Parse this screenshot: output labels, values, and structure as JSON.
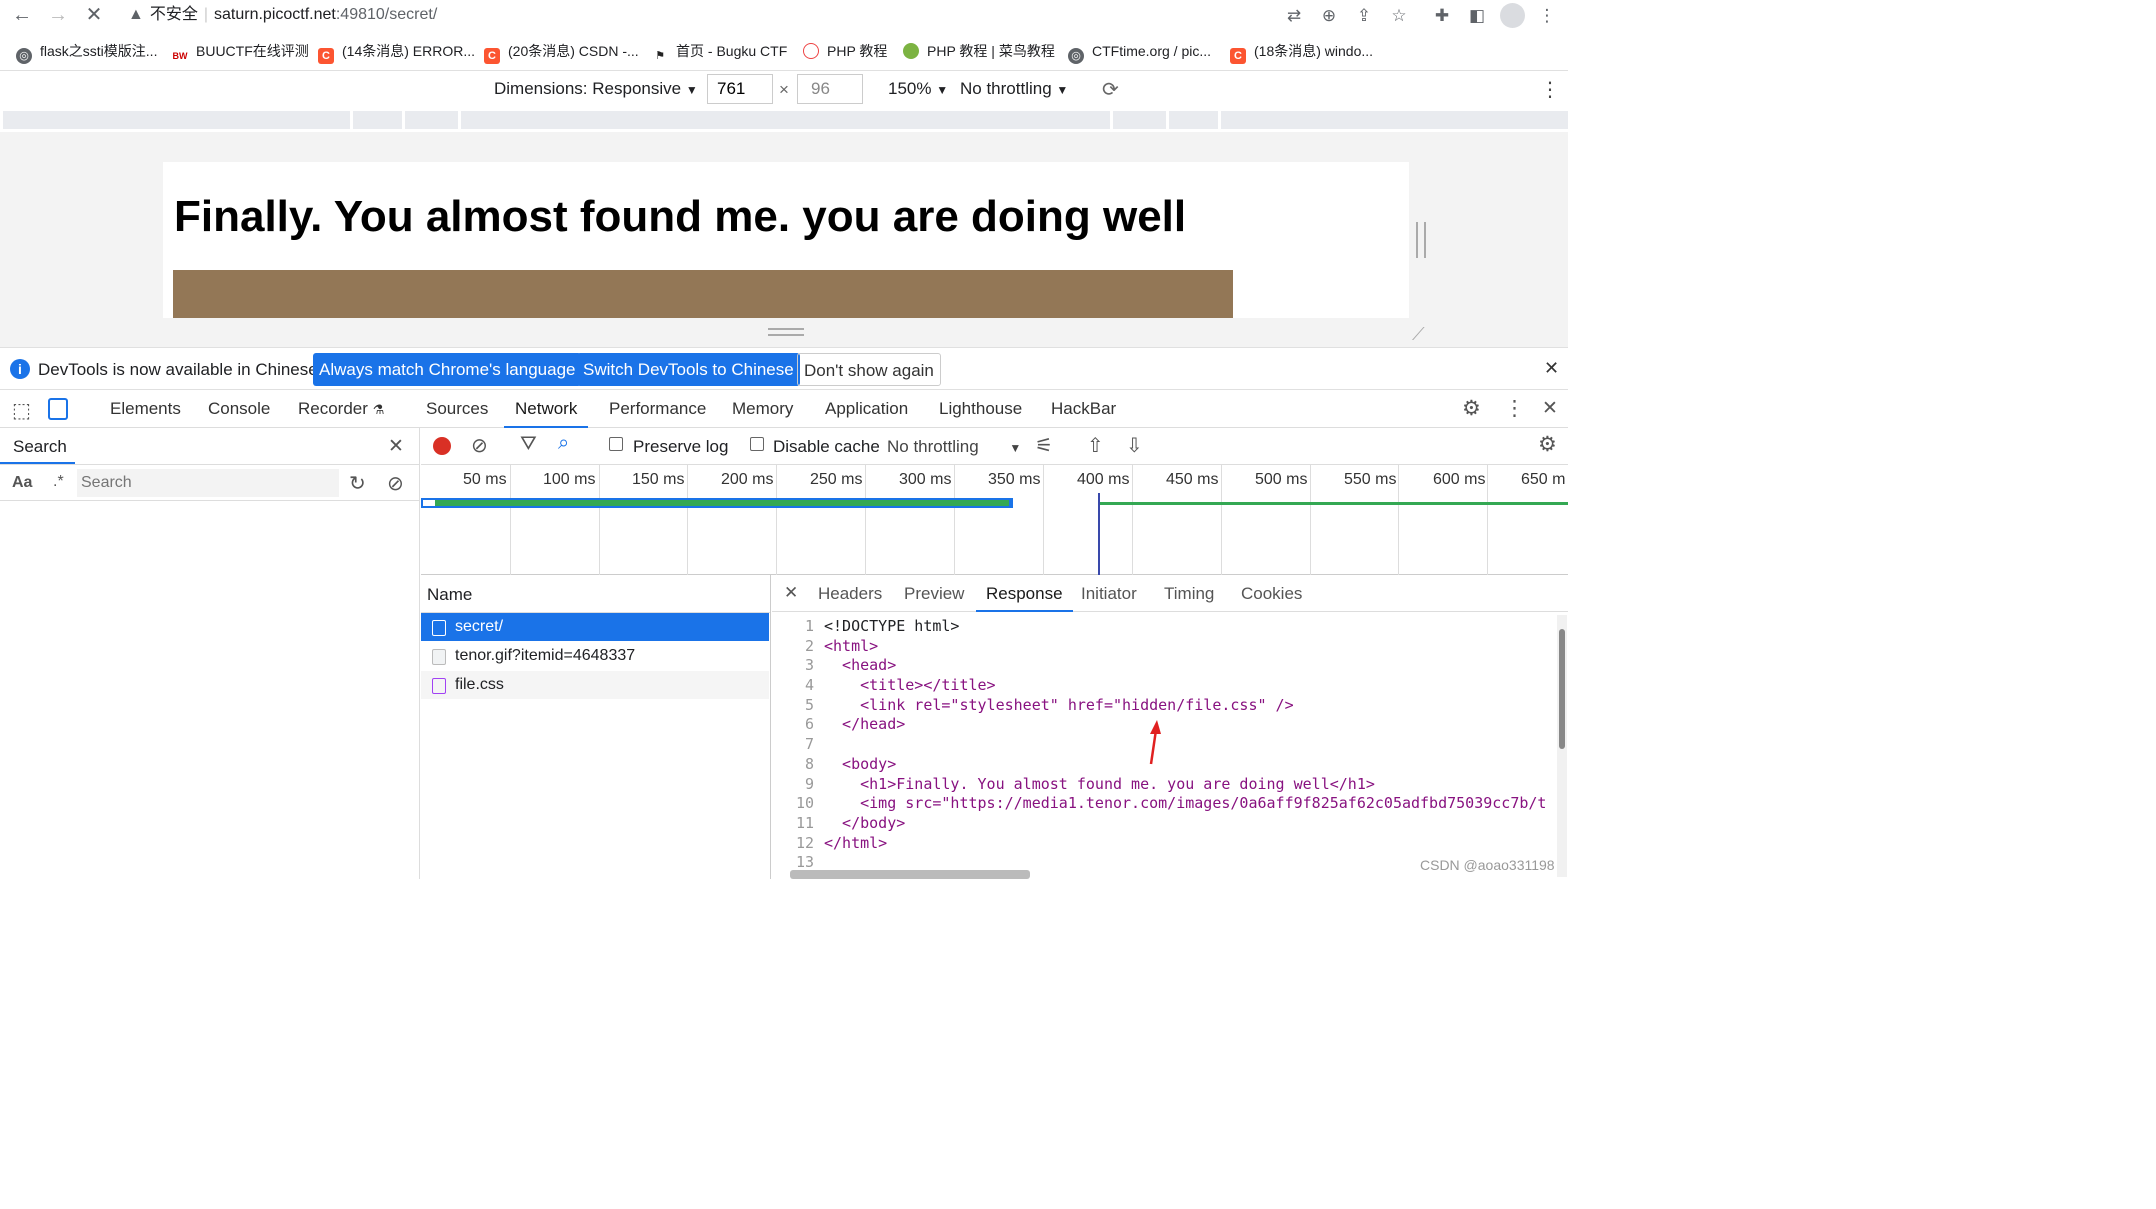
{
  "browser": {
    "url_warning": "不安全",
    "url_host": "saturn.picoctf.net",
    "url_path": ":49810/secret/"
  },
  "bookmarks": [
    {
      "label": "flask之ssti模版注...",
      "icon": "globe-icon"
    },
    {
      "label": "BUUCTF在线评测",
      "icon": "buu-icon"
    },
    {
      "label": "(14条消息) ERROR...",
      "icon": "csdn-icon"
    },
    {
      "label": "(20条消息) CSDN -...",
      "icon": "csdn-icon"
    },
    {
      "label": "首页 - Bugku CTF",
      "icon": "flag-icon"
    },
    {
      "label": "PHP 教程",
      "icon": "php-icon"
    },
    {
      "label": "PHP 教程 | 菜鸟教程",
      "icon": "runoob-icon"
    },
    {
      "label": "CTFtime.org / pic...",
      "icon": "globe-icon"
    },
    {
      "label": "(18条消息) windo...",
      "icon": "csdn-icon"
    }
  ],
  "device_toolbar": {
    "dimensions_label": "Dimensions: Responsive",
    "width": "761",
    "height": "96",
    "zoom": "150%",
    "throttling": "No throttling"
  },
  "page": {
    "heading": "Finally. You almost found me. you are doing well"
  },
  "notice": {
    "text": "DevTools is now available in Chinese!",
    "btn_match": "Always match Chrome's language",
    "btn_switch": "Switch DevTools to Chinese",
    "btn_dismiss": "Don't show again"
  },
  "devtools_tabs": [
    "Elements",
    "Console",
    "Recorder",
    "Sources",
    "Network",
    "Performance",
    "Memory",
    "Application",
    "Lighthouse",
    "HackBar"
  ],
  "active_tab": "Network",
  "search_panel": {
    "title": "Search",
    "case_label": "Aa",
    "regex_label": ".*",
    "placeholder": "Search"
  },
  "network_toolbar": {
    "preserve_log": "Preserve log",
    "disable_cache": "Disable cache",
    "throttling": "No throttling"
  },
  "timeline_ticks": [
    "50 ms",
    "100 ms",
    "150 ms",
    "200 ms",
    "250 ms",
    "300 ms",
    "350 ms",
    "400 ms",
    "450 ms",
    "500 ms",
    "550 ms",
    "600 ms",
    "650 m"
  ],
  "requests": {
    "header": "Name",
    "rows": [
      {
        "name": "secret/",
        "type": "document"
      },
      {
        "name": "tenor.gif?itemid=4648337",
        "type": "image"
      },
      {
        "name": "file.css",
        "type": "stylesheet"
      }
    ]
  },
  "detail_tabs": [
    "Headers",
    "Preview",
    "Response",
    "Initiator",
    "Timing",
    "Cookies"
  ],
  "active_detail_tab": "Response",
  "response_lines": [
    "<!DOCTYPE html>",
    "<html>",
    "  <head>",
    "    <title></title>",
    "    <link rel=\"stylesheet\" href=\"hidden/file.css\" />",
    "  </head>",
    "",
    "  <body>",
    "    <h1>Finally. You almost found me. you are doing well</h1>",
    "    <img src=\"https://media1.tenor.com/images/0a6aff9f825af62c05adfbd75039cc7b/t",
    "  </body>",
    "</html>",
    ""
  ],
  "watermark": "CSDN @aoao331198",
  "colors": {
    "accent": "#1a73e8",
    "record": "#d93025"
  }
}
